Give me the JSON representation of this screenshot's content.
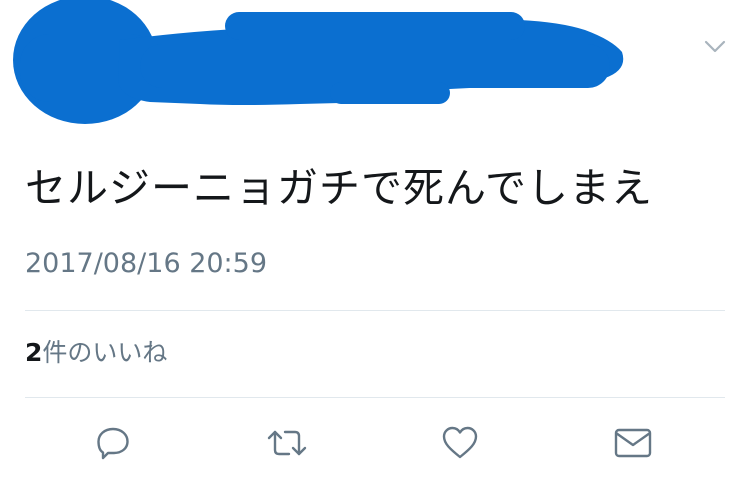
{
  "tweet": {
    "text": "セルジーニョガチで死んでしまえ",
    "timestamp": "2017/08/16 20:59",
    "likes": {
      "count": "2",
      "label": "件のいいね"
    }
  },
  "icons": {
    "more": "chevron-down-icon",
    "reply": "reply-icon",
    "retweet": "retweet-icon",
    "like": "heart-icon",
    "message": "envelope-icon"
  },
  "colors": {
    "redaction": "#0b6fd0",
    "text": "#14171a",
    "secondary": "#657786",
    "icon": "#657786",
    "divider": "#e1e8ed"
  }
}
